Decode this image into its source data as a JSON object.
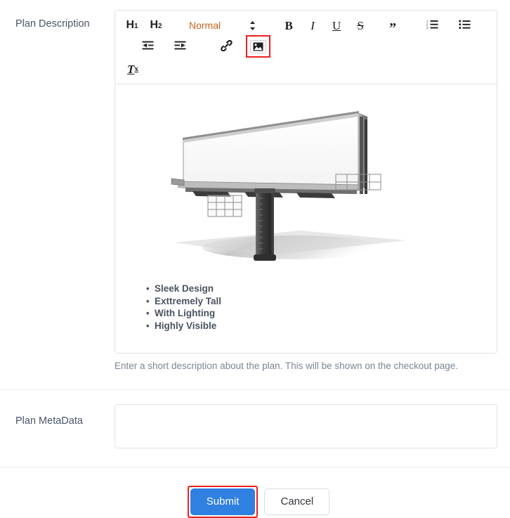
{
  "form": {
    "description_field": {
      "label": "Plan Description",
      "help_text": "Enter a short description about the plan. This will be shown on the checkout page.",
      "toolbar": {
        "h1_label": "H",
        "h1_sub": "1",
        "h2_label": "H",
        "h2_sub": "2",
        "block_format_value": "Normal",
        "bold_label": "B",
        "italic_label": "I",
        "underline_label": "U",
        "strike_label": "S",
        "blockquote_label": "”",
        "clear_format_label": "T",
        "clear_format_sub": "x",
        "icons": {
          "ordered_list": "ordered-list-icon",
          "bullet_list": "bullet-list-icon",
          "outdent": "outdent-icon",
          "indent": "indent-icon",
          "link": "link-icon",
          "image": "image-icon",
          "select_caret": "select-updown-icon"
        },
        "highlighted_button": "image-icon"
      },
      "content": {
        "image_alt": "blank-billboard-render",
        "bullets": [
          "Sleek Design",
          "Exttremely Tall",
          "With Lighting",
          "Highly Visible"
        ]
      }
    },
    "metadata_field": {
      "label": "Plan MetaData",
      "value": "",
      "placeholder": ""
    },
    "actions": {
      "submit_label": "Submit",
      "cancel_label": "Cancel",
      "highlighted_button": "submit-button"
    }
  },
  "colors": {
    "primary": "#2f80e0",
    "highlight": "#f01e1e",
    "select_text": "#c8641d",
    "label": "#4a5568",
    "help": "#7b8696",
    "border": "#dfe2e6"
  }
}
